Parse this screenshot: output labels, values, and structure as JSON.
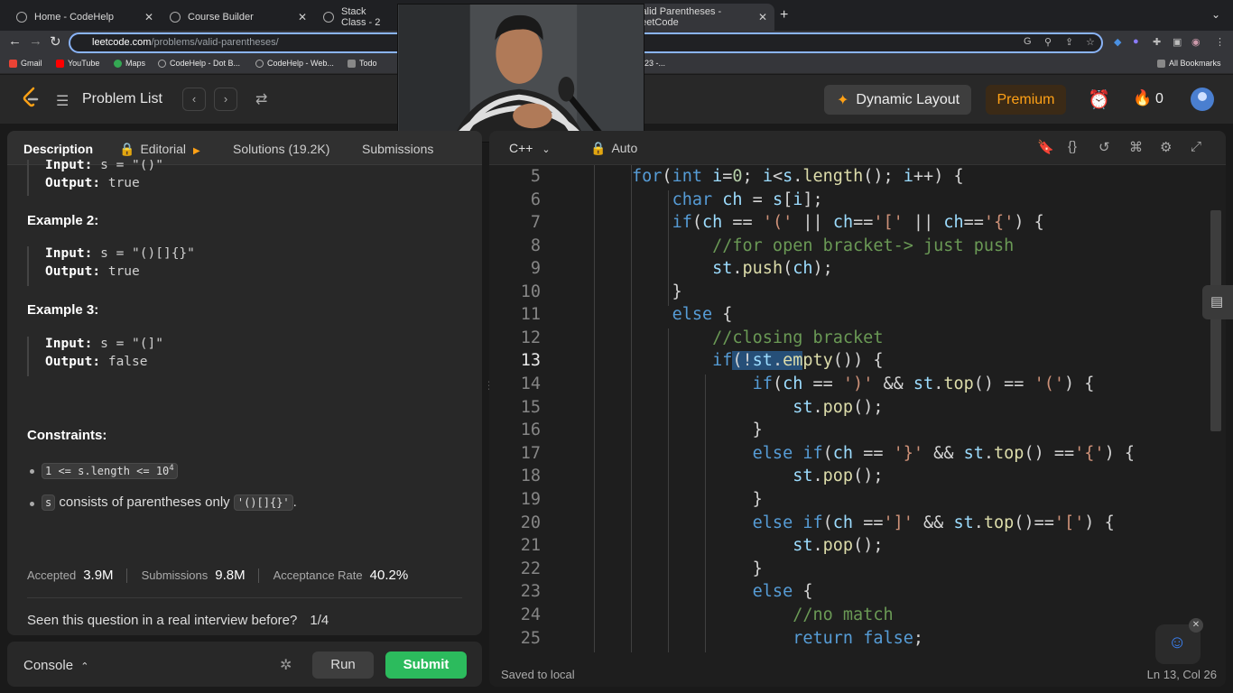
{
  "browser": {
    "tabs": [
      {
        "title": "Home - CodeHelp"
      },
      {
        "title": "Course Builder"
      },
      {
        "title": "Stack Class - 2"
      },
      {
        "title": "Valid Parentheses - LeetCode"
      }
    ],
    "url_domain": "leetcode.com",
    "url_path": "/problems/valid-parentheses/",
    "bookmarks": [
      "Gmail",
      "YouTube",
      "Maps",
      "CodeHelp - Dot B...",
      "CodeHelp - Web...",
      "Todo",
      "23 -..."
    ],
    "all_bookmarks": "All Bookmarks"
  },
  "header": {
    "problem_list": "Problem List",
    "dynamic_layout": "Dynamic Layout",
    "premium": "Premium",
    "streak": "0"
  },
  "description_panel": {
    "tabs": {
      "description": "Description",
      "editorial": "Editorial",
      "solutions": "Solutions (19.2K)",
      "submissions": "Submissions"
    },
    "example1_partial": {
      "input_label": "Input:",
      "input_value": "s = \"()\"",
      "output_label": "Output:",
      "output_value": "true"
    },
    "example2": {
      "title": "Example 2:",
      "input_label": "Input:",
      "input_value": "s = \"()[]{}\"",
      "output_label": "Output:",
      "output_value": "true"
    },
    "example3": {
      "title": "Example 3:",
      "input_label": "Input:",
      "input_value": "s = \"(]\"",
      "output_label": "Output:",
      "output_value": "false"
    },
    "constraints_title": "Constraints:",
    "constraint1_code": "1 <= s.length <= 10",
    "constraint1_sup": "4",
    "constraint2_code": "s",
    "constraint2_text": "consists of parentheses only",
    "constraint2_code2": "'()[]{}'",
    "constraint2_end": ".",
    "stats": {
      "accepted_label": "Accepted",
      "accepted_value": "3.9M",
      "submissions_label": "Submissions",
      "submissions_value": "9.8M",
      "rate_label": "Acceptance Rate",
      "rate_value": "40.2%"
    },
    "seen_question": "Seen this question in a real interview before?",
    "seen_count": "1/4"
  },
  "console": {
    "label": "Console",
    "run": "Run",
    "submit": "Submit"
  },
  "editor": {
    "language": "C++",
    "mode": "Auto",
    "line_numbers": [
      "5",
      "6",
      "7",
      "8",
      "9",
      "10",
      "11",
      "12",
      "13",
      "14",
      "15",
      "16",
      "17",
      "18",
      "19",
      "20",
      "21",
      "22",
      "23",
      "24",
      "25"
    ],
    "current_line": "13",
    "saved": "Saved to local",
    "cursor_pos": "Ln 13, Col 26"
  },
  "colors": {
    "accent": "#ffa116",
    "submit": "#2cbb5d",
    "selection": "#264f78"
  }
}
